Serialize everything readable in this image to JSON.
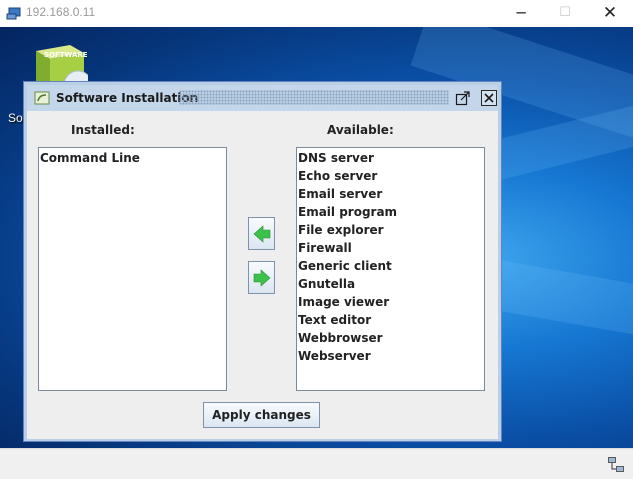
{
  "window": {
    "title": "192.168.0.11",
    "minimize_glyph": "─",
    "maximize_glyph": "☐",
    "close_glyph": "✕"
  },
  "desktop": {
    "icon_label": "Sof"
  },
  "dialog": {
    "title": "Software Installation",
    "installed_label": "Installed:",
    "available_label": "Available:",
    "installed_items": [
      "Command Line"
    ],
    "available_items": [
      "DNS server",
      "Echo server",
      "Email server",
      "Email program",
      "File explorer",
      "Firewall",
      "Generic client",
      "Gnutella",
      "Image viewer",
      "Text editor",
      "Webbrowser",
      "Webserver"
    ],
    "apply_label": "Apply changes"
  },
  "icons": {
    "app": "remote-desktop-icon",
    "desktop_software": "software-box-icon",
    "move_left": "green-arrow-left-icon",
    "move_right": "green-arrow-right-icon",
    "status": "network-icon"
  },
  "colors": {
    "dialog_frame": "#b8cfe5",
    "arrow_green": "#3cc24a",
    "desktop_blue": "#0a4fa6"
  }
}
